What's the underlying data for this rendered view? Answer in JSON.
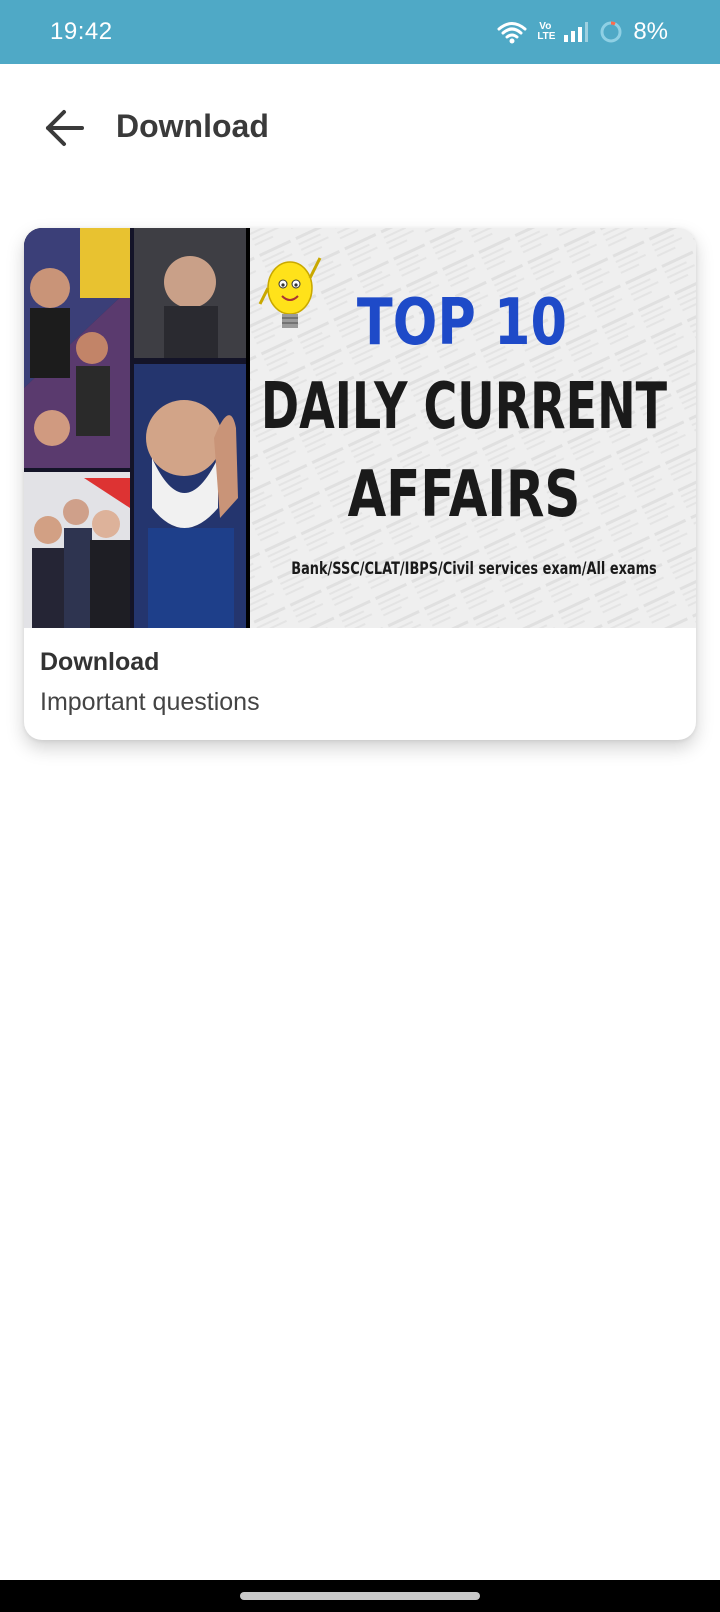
{
  "status_bar": {
    "time": "19:42",
    "volte_top": "Vo",
    "volte_bottom": "LTE",
    "battery": "8%",
    "background": "#4fa9c6"
  },
  "header": {
    "back_icon": "arrow-back-icon",
    "title": "Download"
  },
  "card": {
    "thumbnail": {
      "headline_top": "TOP 10",
      "headline_line1": "DAILY CURRENT",
      "headline_line2": "AFFAIRS",
      "tagline": "Bank/SSC/CLAT/IBPS/Civil services exam/All exams"
    },
    "title": "Download",
    "subtitle": "Important questions"
  }
}
